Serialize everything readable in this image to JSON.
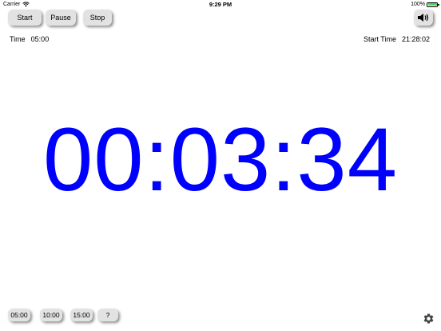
{
  "status_bar": {
    "carrier": "Carrier",
    "time": "9:29 PM",
    "battery": "100%",
    "battery_level": 1.0
  },
  "toolbar": {
    "start_label": "Start",
    "pause_label": "Pause",
    "stop_label": "Stop",
    "sound_icon": "speaker-icon"
  },
  "info": {
    "time_label": "Time",
    "time_value": "05:00",
    "start_time_label": "Start Time",
    "start_time_value": "21:28:02"
  },
  "timer": {
    "display": "00:03:34",
    "color": "#0000ff"
  },
  "presets": {
    "items": [
      "05:00",
      "10:00",
      "15:00",
      "?"
    ]
  },
  "settings": {
    "icon": "gear-icon"
  }
}
